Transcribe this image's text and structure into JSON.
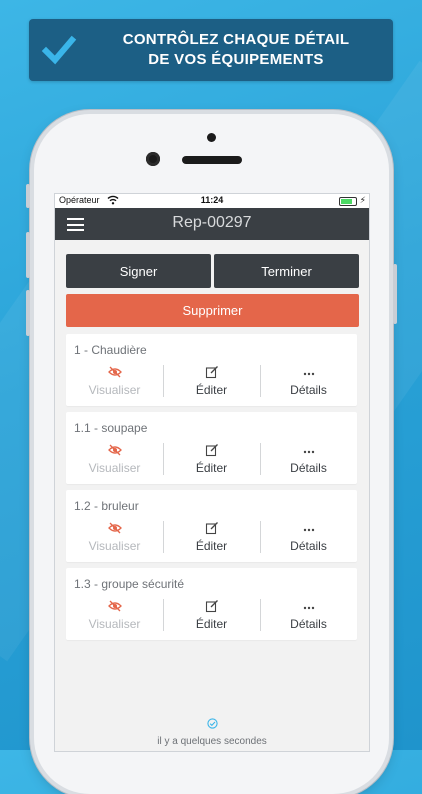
{
  "banner": {
    "line1": "CONTRÔLEZ CHAQUE DÉTAIL",
    "line2": "DE VOS ÉQUIPEMENTS"
  },
  "statusbar": {
    "carrier": "Opérateur",
    "time": "11:24"
  },
  "appbar": {
    "title": "Rep-00297"
  },
  "actions": {
    "sign": "Signer",
    "finish": "Terminer",
    "delete": "Supprimer"
  },
  "items": [
    {
      "name": "1 - Chaudière",
      "view": "Visualiser",
      "edit": "Éditer",
      "details": "Détails"
    },
    {
      "name": "1.1 - soupape",
      "view": "Visualiser",
      "edit": "Éditer",
      "details": "Détails"
    },
    {
      "name": "1.2 - bruleur",
      "view": "Visualiser",
      "edit": "Éditer",
      "details": "Détails"
    },
    {
      "name": "1.3 - groupe sécurité",
      "view": "Visualiser",
      "edit": "Éditer",
      "details": "Détails"
    }
  ],
  "footer": {
    "sync": "il y a quelques secondes"
  },
  "colors": {
    "background": "#2aa3d8",
    "banner": "#1c5f85",
    "check": "#3ab5e9",
    "appbar": "#3a3f44",
    "delete": "#e4664a",
    "visualiser_icon": "#e4664a"
  }
}
